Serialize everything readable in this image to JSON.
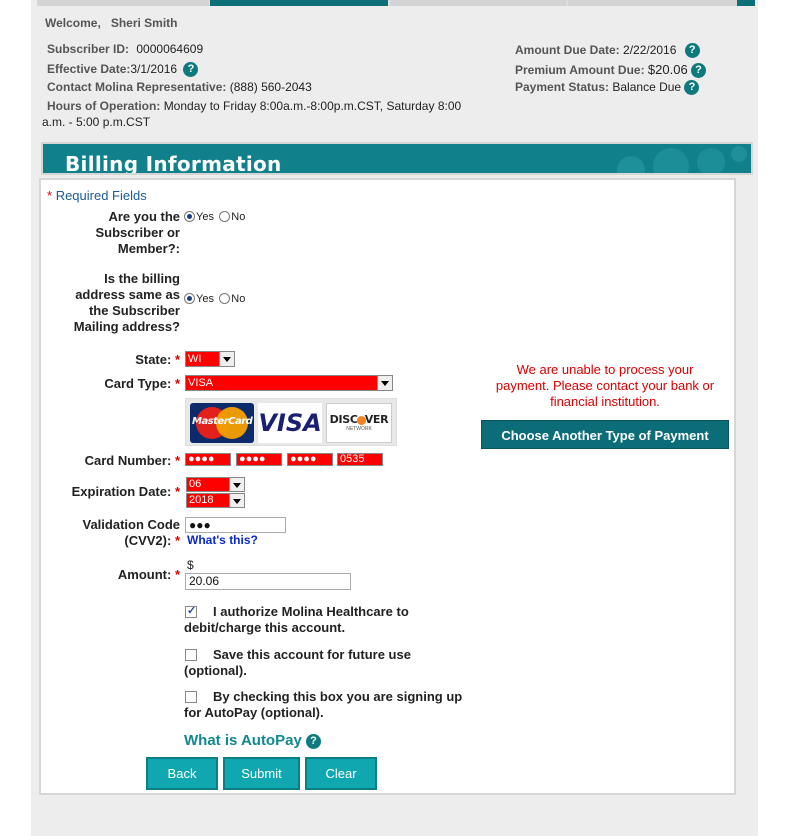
{
  "header": {
    "welcome_label": "Welcome,",
    "user_name": "Sheri Smith",
    "subscriber_id_label": "Subscriber ID:",
    "subscriber_id": "0000064609",
    "effective_date_label": "Effective Date:",
    "effective_date": "3/1/2016",
    "contact_label": "Contact Molina Representative:",
    "contact_phone": "(888) 560-2043",
    "hours_label": "Hours of Operation:",
    "hours_line1": "Monday to Friday 8:00a.m.-8:00p.m.CST, Saturday 8:00",
    "hours_line2": "a.m. - 5:00 p.m.CST",
    "amount_due_date_label": "Amount Due Date:",
    "amount_due_date": "2/22/2016",
    "premium_label": "Premium Amount Due:",
    "premium_amount": "$20.06",
    "payment_status_label": "Payment Status:",
    "payment_status": "Balance Due",
    "help_glyph": "?"
  },
  "banner": {
    "title": "Billing Information"
  },
  "form": {
    "required_star": "*",
    "required_text": "Required Fields",
    "subscriber_q_line1": "Are you the",
    "subscriber_q_line2": "Subscriber or",
    "subscriber_q_line3": "Member?:",
    "billing_q_line1": "Is the billing",
    "billing_q_line2": "address same as",
    "billing_q_line3": "the Subscriber",
    "billing_q_line4": "Mailing address?",
    "yes": "Yes",
    "no": "No",
    "state_label": "State:",
    "state_value": "WI",
    "card_type_label": "Card Type:",
    "card_type_value": "VISA",
    "card_logos": {
      "mastercard": "MasterCard",
      "visa": "VISA",
      "discover": "DISC",
      "discover_end": "VER",
      "discover_sub": "NETWORK"
    },
    "card_number_label": "Card Number:",
    "card_number_parts": [
      "●●●●",
      "●●●●",
      "●●●●",
      "0535"
    ],
    "expiration_label": "Expiration Date:",
    "exp_month": "06",
    "exp_year": "2018",
    "cvv_label_line1": "Validation Code",
    "cvv_label_line2": "(CVV2):",
    "cvv_value": "●●●",
    "cvv_help": "What's this?",
    "amount_label": "Amount:",
    "currency": "$",
    "amount_value": "20.06",
    "authorize_text_line1": "I authorize Molina Healthcare to",
    "authorize_text_line2": "debit/charge this account.",
    "save_text_line1": "Save this account for future use",
    "save_text_line2": "(optional).",
    "autopay_text_line1": "By checking this box you are signing up",
    "autopay_text_line2": "for AutoPay (optional).",
    "what_is_autopay": "What is AutoPay"
  },
  "buttons": {
    "back": "Back",
    "submit": "Submit",
    "clear": "Clear"
  },
  "error": {
    "line1": "We are unable to process your",
    "line2": "payment. Please contact your bank or",
    "line3": "financial institution.",
    "choose_button": "Choose Another Type of Payment"
  },
  "colors": {
    "teal": "#10808a",
    "error_red": "#d60000",
    "button_teal": "#11a7b0"
  }
}
